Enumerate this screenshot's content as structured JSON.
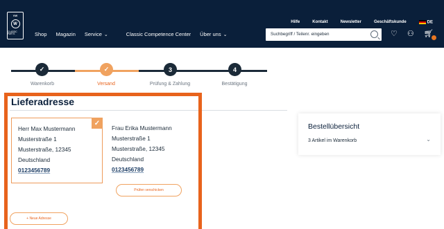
{
  "header": {
    "logo": {
      "top": "VW",
      "mark": "W",
      "bottom": "CLASSIC PARTS"
    },
    "top_links": [
      "Hilfe",
      "Kontakt",
      "Newsletter",
      "Geschäftskunde"
    ],
    "language": "DE",
    "nav": [
      {
        "label": "Shop",
        "dropdown": false
      },
      {
        "label": "Magazin",
        "dropdown": false
      },
      {
        "label": "Service",
        "dropdown": true
      },
      {
        "label": "Classic Competence Center",
        "dropdown": false
      },
      {
        "label": "Über uns",
        "dropdown": true
      }
    ],
    "search_placeholder": "Suchbegriff / Teilenr. eingeben",
    "icons": [
      "search-icon",
      "heart-icon",
      "user-icon",
      "cart-icon"
    ],
    "colors": {
      "bg": "#0a1f3a",
      "accent": "#e87722"
    }
  },
  "stepper": {
    "steps": [
      {
        "number": "✓",
        "label": "Warenkorb",
        "state": "done"
      },
      {
        "number": "✓",
        "label": "Versand",
        "state": "active"
      },
      {
        "number": "3",
        "label": "Prüfung & Zahlung",
        "state": "todo"
      },
      {
        "number": "4",
        "label": "Bestätigung",
        "state": "todo"
      }
    ]
  },
  "main": {
    "section_title": "Lieferadresse",
    "addresses": [
      {
        "name": "Herr Max Mustermann",
        "street": "Musterstraße 1",
        "city": "Musterstraße, 12345",
        "country": "Deutschland",
        "phone": "0123456789",
        "selected": true
      },
      {
        "name": "Frau Erika Mustermann",
        "street": "Musterstraße 1",
        "city": "Musterstraße, 12345",
        "country": "Deutschland",
        "phone": "0123456789",
        "selected": false
      }
    ],
    "edit_label": "Prüfen verschicken",
    "new_address_label": "+ Neue Adresse"
  },
  "summary": {
    "title": "Bestellübersicht",
    "items_label": "3 Artikel im Warenkorb"
  }
}
